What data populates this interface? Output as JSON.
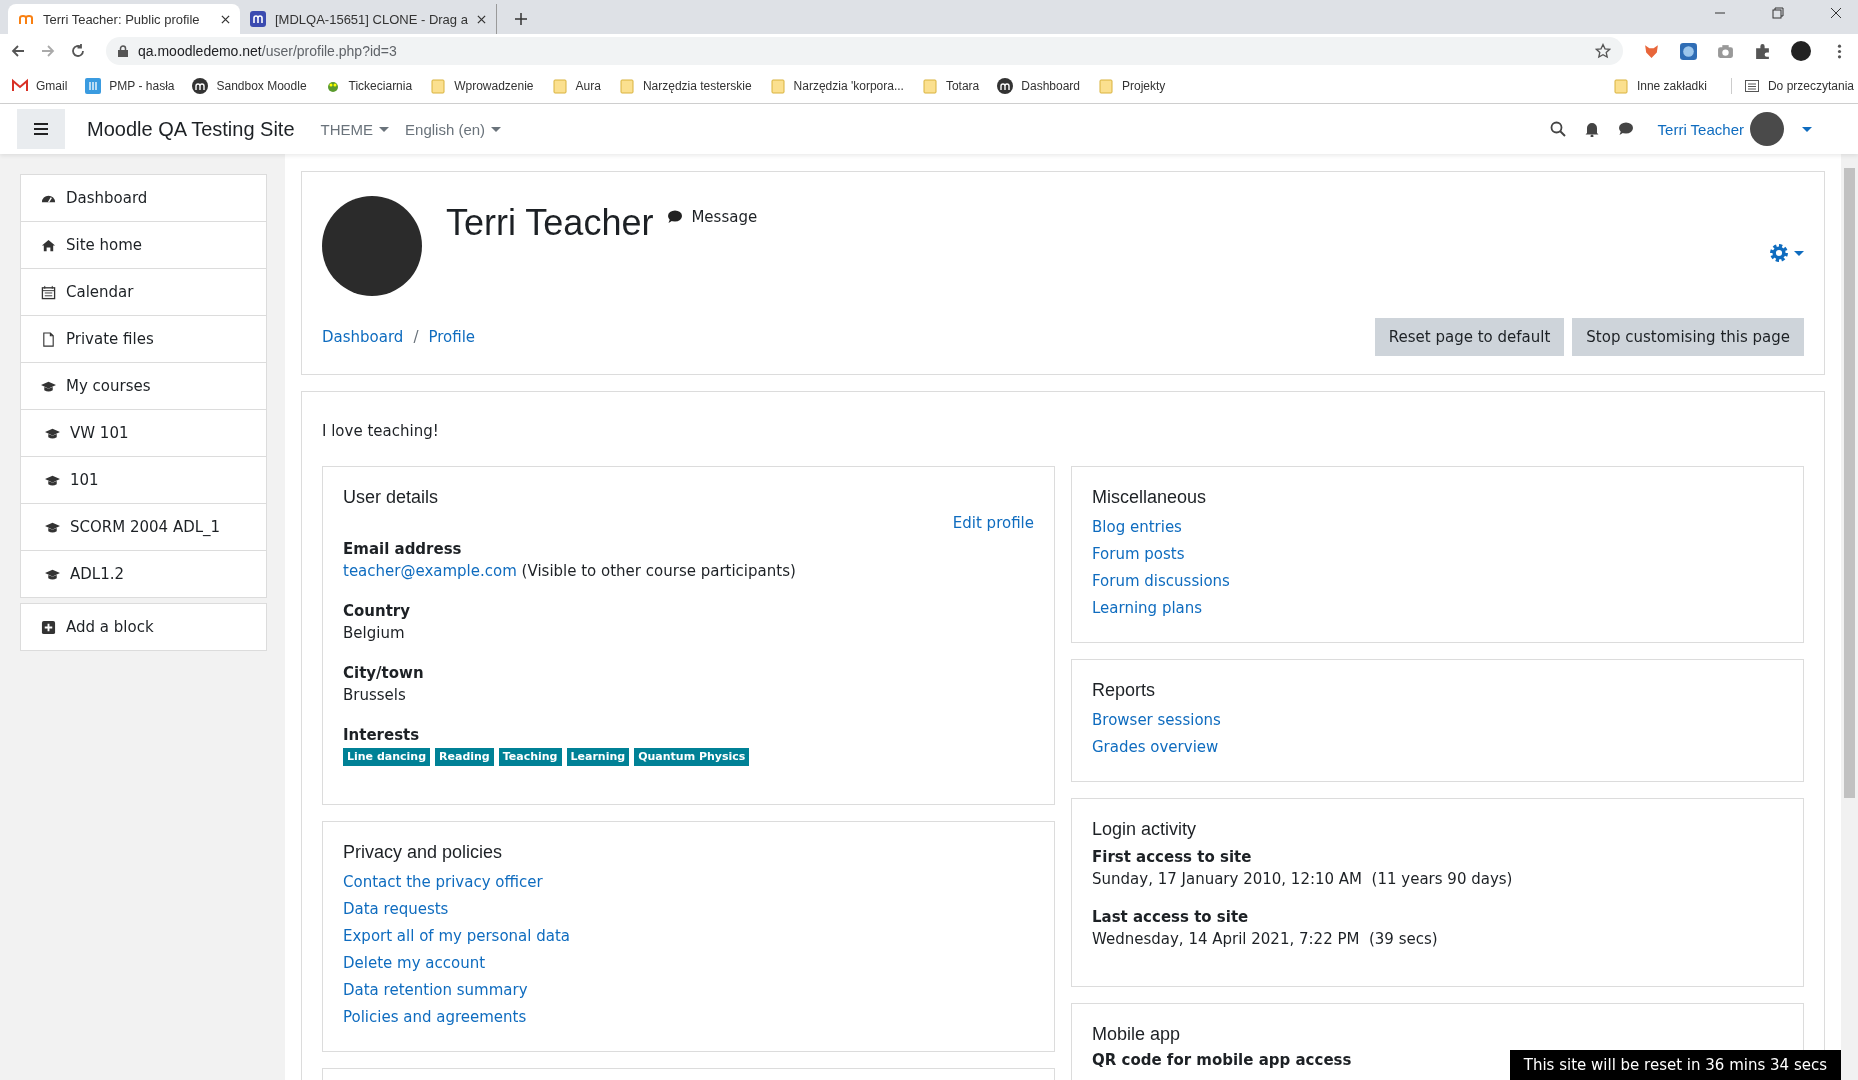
{
  "browser": {
    "tabs": [
      {
        "title": "Terri Teacher: Public profile",
        "selected": true,
        "kind": "moodle"
      },
      {
        "title": "[MDLQA-15651] CLONE - Drag a",
        "selected": false,
        "kind": "tracker"
      }
    ],
    "address": {
      "host": "qa.moodledemo.net",
      "path": "/user/profile.php?id=3"
    },
    "bookmarks": [
      {
        "label": "Gmail",
        "kind": "gmail"
      },
      {
        "label": "PMP - hasła",
        "kind": "app"
      },
      {
        "label": "Sandbox Moodle",
        "kind": "moodle"
      },
      {
        "label": "Tickeciarnia",
        "kind": "bug"
      },
      {
        "label": "Wprowadzenie",
        "kind": "folder"
      },
      {
        "label": "Aura",
        "kind": "folder"
      },
      {
        "label": "Narzędzia testerskie",
        "kind": "folder"
      },
      {
        "label": "Narzędzia 'korpora...",
        "kind": "folder"
      },
      {
        "label": "Totara",
        "kind": "folder"
      },
      {
        "label": "Dashboard",
        "kind": "moodle"
      },
      {
        "label": "Projekty",
        "kind": "folder"
      }
    ],
    "other_bookmarks": "Inne zakładki",
    "reading_list": "Do przeczytania"
  },
  "navbar": {
    "site_name": "Moodle QA Testing Site",
    "menus": [
      "THEME",
      "English (en)"
    ],
    "user_name": "Terri Teacher"
  },
  "sidebar": {
    "items": [
      {
        "label": "Dashboard",
        "kind": "dashboard"
      },
      {
        "label": "Site home",
        "kind": "home"
      },
      {
        "label": "Calendar",
        "kind": "calendar"
      },
      {
        "label": "Private files",
        "kind": "file"
      },
      {
        "label": "My courses",
        "kind": "cap",
        "children": [
          {
            "label": "VW 101",
            "kind": "cap"
          },
          {
            "label": "101",
            "kind": "cap"
          },
          {
            "label": "SCORM 2004 ADL_1",
            "kind": "cap"
          },
          {
            "label": "ADL1.2",
            "kind": "cap"
          }
        ]
      }
    ],
    "add_block": "Add a block"
  },
  "header": {
    "name": "Terri Teacher",
    "message": "Message",
    "breadcrumb": [
      "Dashboard",
      "Profile"
    ],
    "breadcrumb_separator": "/",
    "buttons": [
      "Reset page to default",
      "Stop customising this page"
    ]
  },
  "description": "I love teaching!",
  "user_details": {
    "title": "User details",
    "edit_link": "Edit profile",
    "email": {
      "label": "Email address",
      "link": "teacher@example.com",
      "note": "(Visible to other course participants)"
    },
    "fields": [
      {
        "label": "Country",
        "value": "Belgium"
      },
      {
        "label": "City/town",
        "value": "Brussels"
      }
    ],
    "interests": {
      "label": "Interests",
      "tags": [
        "Line dancing",
        "Reading",
        "Teaching",
        "Learning",
        "Quantum Physics"
      ]
    }
  },
  "privacy": {
    "title": "Privacy and policies",
    "links": [
      "Contact the privacy officer",
      "Data requests",
      "Export all of my personal data",
      "Delete my account",
      "Data retention summary",
      "Policies and agreements"
    ]
  },
  "miscellaneous": {
    "title": "Miscellaneous",
    "links": [
      "Blog entries",
      "Forum posts",
      "Forum discussions",
      "Learning plans"
    ]
  },
  "reports": {
    "title": "Reports",
    "links": [
      "Browser sessions",
      "Grades overview"
    ]
  },
  "login_activity": {
    "title": "Login activity",
    "items": [
      {
        "label": "First access to site",
        "value": "Sunday, 17 January 2010, 12:10 AM  (11 years 90 days)"
      },
      {
        "label": "Last access to site",
        "value": "Wednesday, 14 April 2021, 7:22 PM  (39 secs)"
      }
    ]
  },
  "mobile_app": {
    "title": "Mobile app",
    "label": "QR code for mobile app access"
  },
  "reset_notice": "This site will be reset in 36 mins 34 secs"
}
